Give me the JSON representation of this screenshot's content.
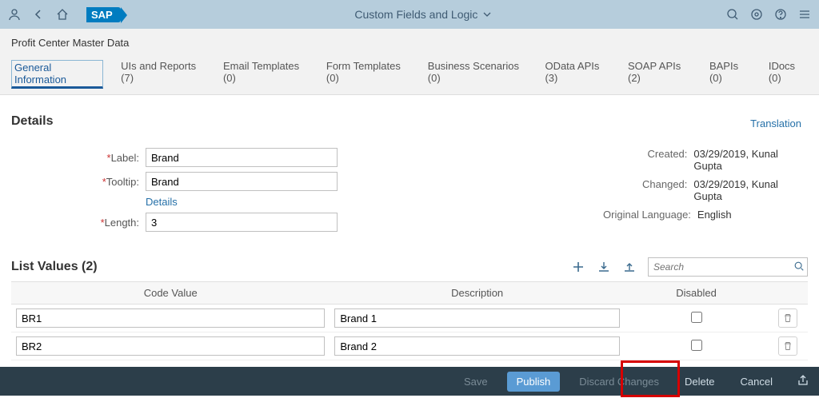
{
  "shell": {
    "title": "Custom Fields and Logic"
  },
  "header": {
    "page_title": "Profit Center Master Data",
    "translation": "Translation"
  },
  "tabs": [
    {
      "label": "General Information"
    },
    {
      "label": "UIs and Reports (7)"
    },
    {
      "label": "Email Templates (0)"
    },
    {
      "label": "Form Templates (0)"
    },
    {
      "label": "Business Scenarios (0)"
    },
    {
      "label": "OData APIs (3)"
    },
    {
      "label": "SOAP APIs (2)"
    },
    {
      "label": "BAPIs (0)"
    },
    {
      "label": "IDocs (0)"
    }
  ],
  "details": {
    "section_title": "Details",
    "label_lbl": "Label:",
    "label_val": "Brand",
    "tooltip_lbl": "Tooltip:",
    "tooltip_val": "Brand",
    "details_link": "Details",
    "length_lbl": "Length:",
    "length_val": "3",
    "created_lbl": "Created:",
    "created_val": "03/29/2019, Kunal Gupta",
    "changed_lbl": "Changed:",
    "changed_val": "03/29/2019, Kunal Gupta",
    "lang_lbl": "Original Language:",
    "lang_val": "English"
  },
  "list": {
    "title": "List Values (2)",
    "search_placeholder": "Search",
    "columns": {
      "code": "Code Value",
      "desc": "Description",
      "disabled": "Disabled"
    },
    "rows": [
      {
        "code": "BR1",
        "desc": "Brand 1",
        "disabled": false
      },
      {
        "code": "BR2",
        "desc": "Brand 2",
        "disabled": false
      }
    ]
  },
  "footer": {
    "save": "Save",
    "publish": "Publish",
    "discard": "Discard Changes",
    "delete": "Delete",
    "cancel": "Cancel"
  }
}
